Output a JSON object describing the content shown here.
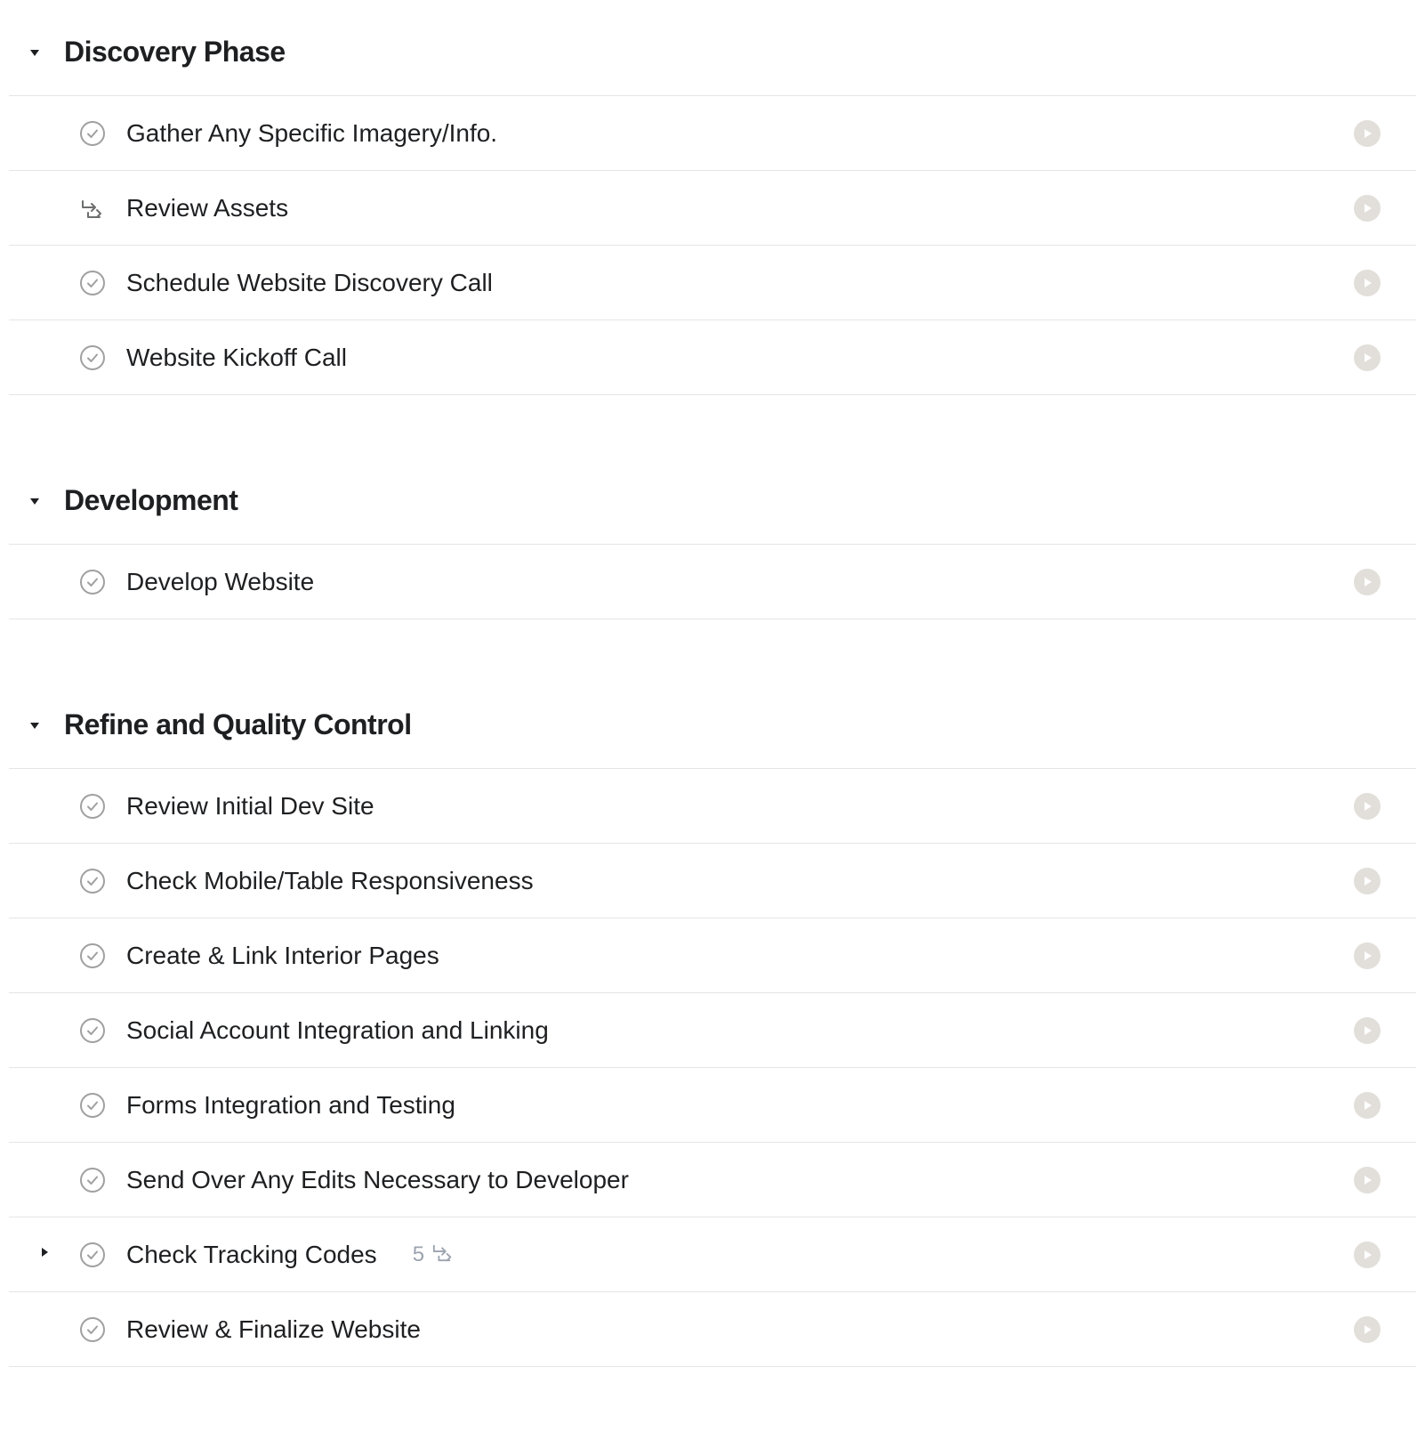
{
  "sections": [
    {
      "title": "Discovery Phase",
      "expanded": true,
      "tasks": [
        {
          "title": "Gather Any Specific Imagery/Info.",
          "icon": "check",
          "hasSubtasks": false,
          "subtaskCount": null,
          "hasExpand": false
        },
        {
          "title": "Review Assets",
          "icon": "subtask",
          "hasSubtasks": false,
          "subtaskCount": null,
          "hasExpand": false
        },
        {
          "title": "Schedule Website Discovery Call",
          "icon": "check",
          "hasSubtasks": false,
          "subtaskCount": null,
          "hasExpand": false
        },
        {
          "title": "Website Kickoff Call",
          "icon": "check",
          "hasSubtasks": false,
          "subtaskCount": null,
          "hasExpand": false
        }
      ]
    },
    {
      "title": "Development",
      "expanded": true,
      "tasks": [
        {
          "title": "Develop Website",
          "icon": "check",
          "hasSubtasks": false,
          "subtaskCount": null,
          "hasExpand": false
        }
      ]
    },
    {
      "title": "Refine and Quality Control",
      "expanded": true,
      "tasks": [
        {
          "title": "Review Initial Dev Site",
          "icon": "check",
          "hasSubtasks": false,
          "subtaskCount": null,
          "hasExpand": false
        },
        {
          "title": "Check Mobile/Table Responsiveness",
          "icon": "check",
          "hasSubtasks": false,
          "subtaskCount": null,
          "hasExpand": false
        },
        {
          "title": "Create & Link Interior Pages",
          "icon": "check",
          "hasSubtasks": false,
          "subtaskCount": null,
          "hasExpand": false
        },
        {
          "title": "Social Account Integration and Linking",
          "icon": "check",
          "hasSubtasks": false,
          "subtaskCount": null,
          "hasExpand": false
        },
        {
          "title": "Forms Integration and Testing",
          "icon": "check",
          "hasSubtasks": false,
          "subtaskCount": null,
          "hasExpand": false
        },
        {
          "title": "Send Over Any Edits Necessary to Developer",
          "icon": "check",
          "hasSubtasks": false,
          "subtaskCount": null,
          "hasExpand": false
        },
        {
          "title": "Check Tracking Codes",
          "icon": "check",
          "hasSubtasks": true,
          "subtaskCount": "5",
          "hasExpand": true
        },
        {
          "title": "Review & Finalize Website",
          "icon": "check",
          "hasSubtasks": false,
          "subtaskCount": null,
          "hasExpand": false
        }
      ]
    }
  ]
}
